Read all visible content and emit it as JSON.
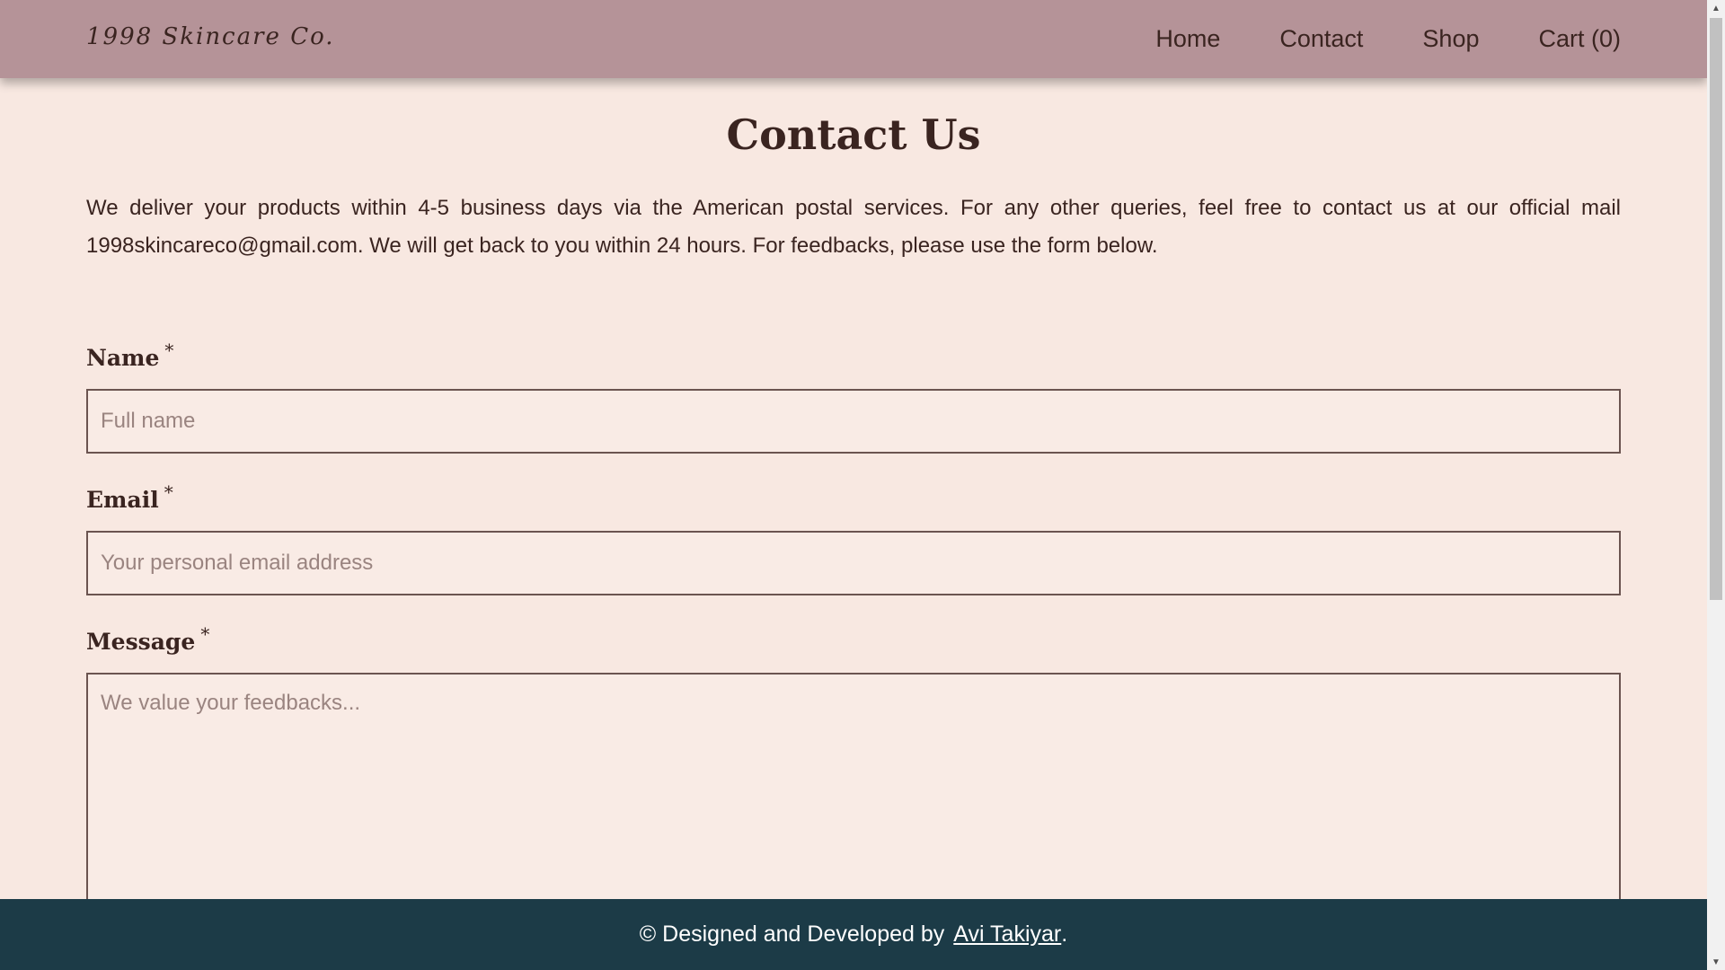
{
  "header": {
    "logo": "1998 Skincare Co.",
    "nav": {
      "home": "Home",
      "contact": "Contact",
      "shop": "Shop",
      "cart": "Cart (0)"
    }
  },
  "main": {
    "title": "Contact Us",
    "intro": "We deliver your products within 4-5 business days via the American postal services. For any other queries, feel free to contact us at our official mail 1998skincareco@gmail.com. We will get back to you within 24 hours. For feedbacks, please use the form below.",
    "form": {
      "name_label": "Name",
      "name_placeholder": "Full name",
      "email_label": "Email",
      "email_placeholder": "Your personal email address",
      "message_label": "Message",
      "message_placeholder": "We value your feedbacks...",
      "required_marker": "*"
    }
  },
  "footer": {
    "text": "© Designed and Developed by",
    "author": "Avi Takiyar",
    "end": "."
  },
  "colors": {
    "header_bg": "#b59398",
    "page_bg": "#f8e8e1",
    "footer_bg": "#1c3b47",
    "text": "#3a2420"
  }
}
